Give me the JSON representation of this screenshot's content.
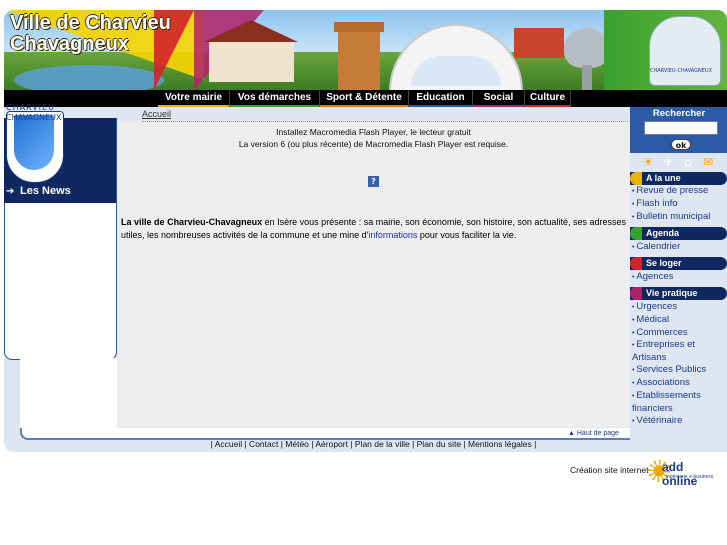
{
  "header": {
    "title_line1": "Ville de Charvieu",
    "title_line2": "Chavagneux",
    "logo_text": "CHARVIEU-CHAVAGNEUX"
  },
  "nav": {
    "items": [
      {
        "label": "Votre mairie",
        "color": "#e8b400"
      },
      {
        "label": "Vos démarches",
        "color": "#3aa02e"
      },
      {
        "label": "Sport & Détente",
        "color": "#e07b00"
      },
      {
        "label": "Education",
        "color": "#2c5aa6"
      },
      {
        "label": "Social",
        "color": "#b0216a"
      },
      {
        "label": "Culture",
        "color": "#d2232a"
      }
    ]
  },
  "left": {
    "coat_top": "CHARVIEU",
    "coat_side": "CHAVAGNEUX",
    "news_title": "Les News"
  },
  "breadcrumb": "Accueil",
  "flash": {
    "line1": "Installez Macromedia Flash Player, le lecteur gratuit",
    "line2": "La version 6 (ou plus récente) de Macromedia Flash Player est requise."
  },
  "intro": {
    "bold": "La ville de Charvieu-Chavagneux",
    "text1": " en Isère vous présente : sa mairie, son économie, son histoire, son actualité, ses adresses utiles, les nombreuses activités de la commune et une mine d'",
    "link": "informations",
    "text2": " pour vous faciliter la vie."
  },
  "haut_de_page": "Haut de page",
  "search": {
    "title": "Rechercher",
    "value": "",
    "button": "ok"
  },
  "utility_icons": [
    "weather-icon",
    "plane-icon",
    "map-icon",
    "mail-icon"
  ],
  "sections": [
    {
      "title": "A la une",
      "color": "#e8b400",
      "links": [
        "Revue de presse",
        "Flash info",
        "Bulletin municipal"
      ]
    },
    {
      "title": "Agenda",
      "color": "#3aa02e",
      "links": [
        "Calendrier"
      ]
    },
    {
      "title": "Se loger",
      "color": "#d2232a",
      "links": [
        "Agences"
      ]
    },
    {
      "title": "Vie pratique",
      "color": "#b0216a",
      "links": [
        "Urgences",
        "Médical",
        "Commerces",
        "Entreprises et Artisans",
        "Services Publics",
        "Associations",
        "Etablissements financiers",
        "Vétérinaire"
      ]
    }
  ],
  "footer": {
    "links": "| Accueil | Contact | Météo | Aéroport | Plan de la ville | Plan du site | Mentions légales |"
  },
  "credit": {
    "text": "Création site internet",
    "logo_main": "add online",
    "logo_sub": "ingénierie e-business"
  }
}
